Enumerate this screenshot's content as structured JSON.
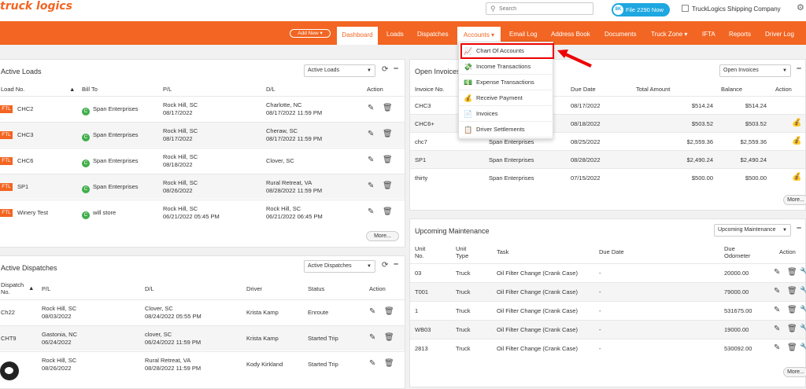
{
  "header": {
    "logo_text": "truck logics",
    "search_placeholder": "Search",
    "file_button_label": "File 2290 Now",
    "file_button_badge": "8K",
    "company_name": "TruckLogics Shipping Company"
  },
  "nav": {
    "add_new": "Add New",
    "items": [
      "Dashboard",
      "Loads",
      "Dispatches",
      "Accounts",
      "Email Log",
      "Address Book",
      "Documents",
      "Truck Zone",
      "IFTA",
      "Reports",
      "Driver Log"
    ]
  },
  "accounts_menu": {
    "items": [
      "Chart Of Accounts",
      "Income Transactions",
      "Expense Transactions",
      "Receive Payment",
      "Invoices",
      "Driver Settlements"
    ]
  },
  "active_loads": {
    "title": "Active Loads",
    "select": "Active Loads",
    "headers": [
      "Load No.",
      "Bill To",
      "P/L",
      "D/L",
      "Action"
    ],
    "rows": [
      {
        "tag": "FTL",
        "load": "CHC2",
        "bill_to": "Span Enterprises",
        "pl_city": "Rock Hill, SC",
        "pl_date": "08/17/2022",
        "dl_city": "Charlotte, NC",
        "dl_date": "08/17/2022 11:59 PM"
      },
      {
        "tag": "FTL",
        "load": "CHC3",
        "bill_to": "Span Enterprises",
        "pl_city": "Rock Hill, SC",
        "pl_date": "08/17/2022",
        "dl_city": "Cheraw, SC",
        "dl_date": "08/17/2022 11:59 PM"
      },
      {
        "tag": "FTL",
        "load": "CHC6",
        "bill_to": "Span Enterprises",
        "pl_city": "Rock Hill, SC",
        "pl_date": "08/18/2022",
        "dl_city": "Clover, SC",
        "dl_date": ""
      },
      {
        "tag": "FTL",
        "load": "SP1",
        "bill_to": "Span Enterprises",
        "pl_city": "Rock Hill, SC",
        "pl_date": "08/26/2022",
        "dl_city": "Rural Retreat, VA",
        "dl_date": "08/28/2022 11:59 PM"
      },
      {
        "tag": "FTL",
        "load": "Winery Test",
        "bill_to": "will store",
        "pl_city": "Rock Hill, SC",
        "pl_date": "06/21/2022 05:45 PM",
        "dl_city": "Rock Hill, SC",
        "dl_date": "06/21/2022 06:45 PM"
      }
    ],
    "more": "More..."
  },
  "open_invoices": {
    "title": "Open Invoices",
    "select": "Open Invoices",
    "headers": [
      "Invoice No.",
      "Due Date",
      "Total Amount",
      "Balance",
      "Action"
    ],
    "rows": [
      {
        "no": "CHC3",
        "bill_to": "",
        "due": "08/17/2022",
        "total": "$514.24",
        "balance": "$514.24",
        "pay": false
      },
      {
        "no": "CHC6+",
        "bill_to": "",
        "due": "08/18/2022",
        "total": "$503.52",
        "balance": "$503.52",
        "pay": true
      },
      {
        "no": "chc7",
        "bill_to": "Span Enterprises",
        "due": "08/25/2022",
        "total": "$2,559.36",
        "balance": "$2,559.36",
        "pay": true
      },
      {
        "no": "SP1",
        "bill_to": "Span Enterprises",
        "due": "08/28/2022",
        "total": "$2,490.24",
        "balance": "$2,490.24",
        "pay": false
      },
      {
        "no": "thirty",
        "bill_to": "Span Enterprises",
        "due": "07/15/2022",
        "total": "$500.00",
        "balance": "$500.00",
        "pay": true
      }
    ],
    "more": "More..."
  },
  "active_dispatches": {
    "title": "Active Dispatches",
    "select": "Active Dispatches",
    "headers": [
      "Dispatch No.",
      "P/L",
      "D/L",
      "Driver",
      "Status",
      "Action"
    ],
    "rows": [
      {
        "no": "Ch22",
        "pl_city": "Rock Hill, SC",
        "pl_date": "08/03/2022",
        "dl_city": "Clover, SC",
        "dl_date": "08/24/2022 05:55 PM",
        "driver": "Krista Kamp",
        "status": "Enroute"
      },
      {
        "no": "CHT9",
        "pl_city": "Gastonia, NC",
        "pl_date": "06/24/2022",
        "dl_city": "clover, SC",
        "dl_date": "06/24/2022 11:59 PM",
        "driver": "Krista Kamp",
        "status": "Started Trip"
      },
      {
        "no": "",
        "pl_city": "Rock Hill, SC",
        "pl_date": "08/26/2022",
        "dl_city": "Rural Retreat, VA",
        "dl_date": "08/28/2022 11:59 PM",
        "driver": "Kody Kirkland",
        "status": "Started Trip"
      }
    ]
  },
  "upcoming_maintenance": {
    "title": "Upcoming Maintenance",
    "select": "Upcoming Maintenance",
    "headers": [
      "Unit No.",
      "Unit Type",
      "Task",
      "Due Date",
      "Due Odometer",
      "Action"
    ],
    "rows": [
      {
        "unit": "03",
        "type": "Truck",
        "task": "Oil Filter Change (Crank Case)",
        "due": "-",
        "odo": "20000.00"
      },
      {
        "unit": "T001",
        "type": "Truck",
        "task": "Oil Filter Change (Crank Case)",
        "due": "-",
        "odo": "79000.00"
      },
      {
        "unit": "1",
        "type": "Truck",
        "task": "Oil Filter Change (Crank Case)",
        "due": "-",
        "odo": "531675.00"
      },
      {
        "unit": "WB03",
        "type": "Truck",
        "task": "Oil Filter Change (Crank Case)",
        "due": "-",
        "odo": "19000.00"
      },
      {
        "unit": "2813",
        "type": "Truck",
        "task": "Oil Filter Change (Crank Case)",
        "due": "-",
        "odo": "530092.00"
      }
    ],
    "more": "More..."
  },
  "colors": {
    "brand": "#f26522",
    "accent": "#1ea7e0",
    "highlight": "#e00000"
  }
}
